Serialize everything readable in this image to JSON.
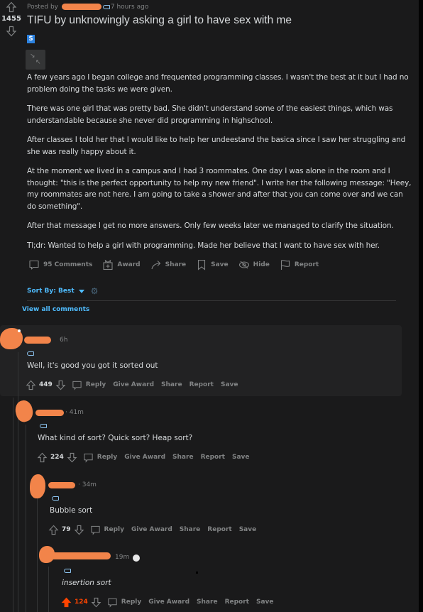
{
  "post": {
    "score": "1455",
    "posted_by_label": "Posted by",
    "time_ago": "7 hours ago",
    "title": "TIFU by unknowingly asking a girl to have sex with me",
    "flair": "S",
    "paragraphs": [
      "A few years ago I began college and frequented programming classes. I wasn't the best at it but I had no problem doing the tasks we were given.",
      "There was one girl that was pretty bad. She didn't understand some of the easiest things, which was understandable because she never did programming in highschool.",
      "After classes I told her that I would like to help her undeestand the basica since I saw her struggling and she was really happy about it.",
      "At the moment we lived in a campus and I had 3 roommates. One day I was alone in the room and I thought: \"this is the perfect opportunity to help my new friend\". I write her the following message: \"Heey, my roommates are not here. I am going to take a shower and after that you can come over and we can do something\".",
      "After that message I get no more answers. Only few weeks later we managed to clarify the situation.",
      "Tl;dr: Wanted to help a girl with programming. Made her believe that I want to have sex with her."
    ],
    "actions": {
      "comments": "95 Comments",
      "award": "Award",
      "share": "Share",
      "save": "Save",
      "hide": "Hide",
      "report": "Report"
    }
  },
  "sort": {
    "label": "Sort By: Best",
    "view_all": "View all comments"
  },
  "comment_actions": {
    "reply": "Reply",
    "give_award": "Give Award",
    "share": "Share",
    "report": "Report",
    "save": "Save"
  },
  "comments": [
    {
      "time": "6h",
      "text": "Well, it's good you got it sorted out",
      "score": "449",
      "upvoted": false
    },
    {
      "time": "· 41m",
      "text": "What kind of sort? Quick sort? Heap sort?",
      "score": "224",
      "upvoted": false
    },
    {
      "time": "· 34m",
      "text": "Bubble sort",
      "score": "79",
      "upvoted": false
    },
    {
      "time": "19m",
      "text": "insertion sort",
      "score": "124",
      "upvoted": true
    }
  ],
  "colors": {
    "background": "#1a1a1b",
    "accent_blue": "#4fbcff",
    "upvote_orange": "#ff4500",
    "redaction": "#f2844a"
  }
}
